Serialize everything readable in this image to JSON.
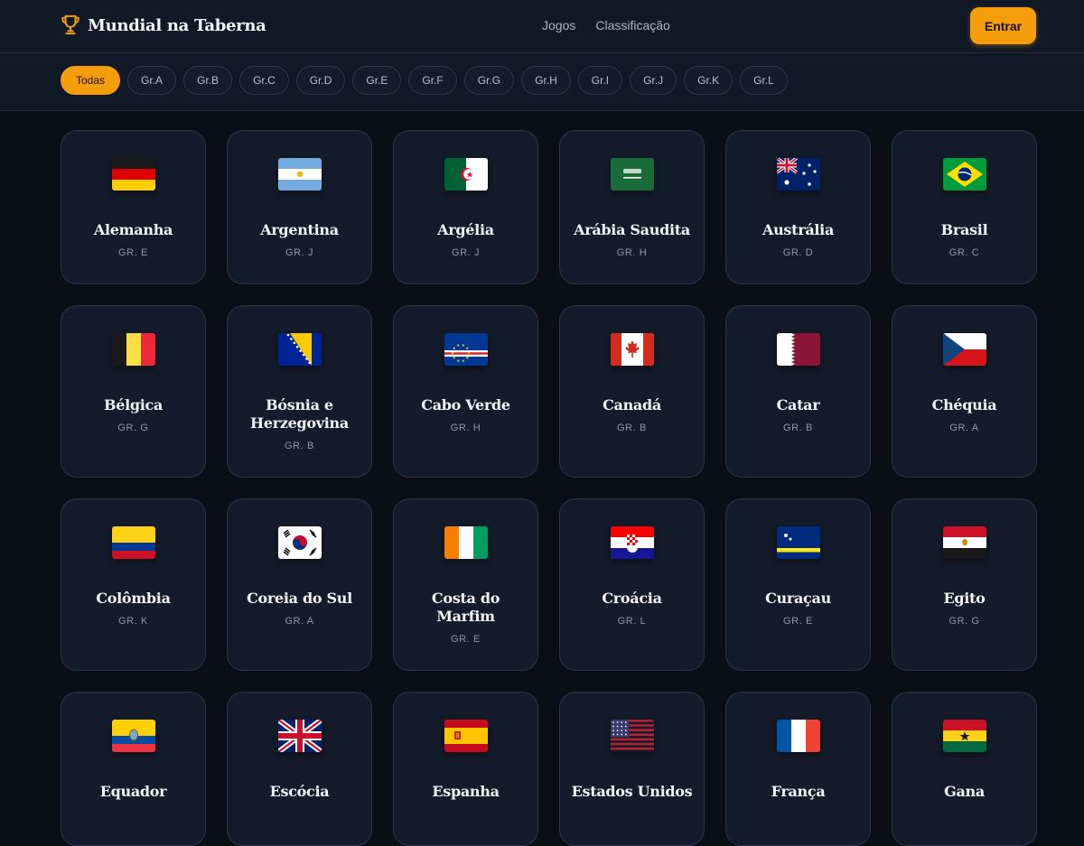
{
  "header": {
    "brand": "Mundial na Taberna",
    "nav": [
      "Jogos",
      "Classificação"
    ],
    "login_label": "Entrar"
  },
  "filters": [
    "Todas",
    "Gr.A",
    "Gr.B",
    "Gr.C",
    "Gr.D",
    "Gr.E",
    "Gr.F",
    "Gr.G",
    "Gr.H",
    "Gr.I",
    "Gr.J",
    "Gr.K",
    "Gr.L"
  ],
  "colors": {
    "accent": "#f59e0b",
    "background": "#0a0e16",
    "card": "#141c2b"
  },
  "teams": [
    {
      "name": "Alemanha",
      "group": "GR. E",
      "flag": "de"
    },
    {
      "name": "Argentina",
      "group": "GR. J",
      "flag": "ar"
    },
    {
      "name": "Argélia",
      "group": "GR. J",
      "flag": "dz"
    },
    {
      "name": "Arábia Saudita",
      "group": "GR. H",
      "flag": "sa"
    },
    {
      "name": "Austrália",
      "group": "GR. D",
      "flag": "au"
    },
    {
      "name": "Brasil",
      "group": "GR. C",
      "flag": "br"
    },
    {
      "name": "Bélgica",
      "group": "GR. G",
      "flag": "be"
    },
    {
      "name": "Bósnia e Herzegovina",
      "group": "GR. B",
      "flag": "ba"
    },
    {
      "name": "Cabo Verde",
      "group": "GR. H",
      "flag": "cv"
    },
    {
      "name": "Canadá",
      "group": "GR. B",
      "flag": "ca"
    },
    {
      "name": "Catar",
      "group": "GR. B",
      "flag": "qa"
    },
    {
      "name": "Chéquia",
      "group": "GR. A",
      "flag": "cz"
    },
    {
      "name": "Colômbia",
      "group": "GR. K",
      "flag": "co"
    },
    {
      "name": "Coreia do Sul",
      "group": "GR. A",
      "flag": "kr"
    },
    {
      "name": "Costa do Marfim",
      "group": "GR. E",
      "flag": "ci"
    },
    {
      "name": "Croácia",
      "group": "GR. L",
      "flag": "hr"
    },
    {
      "name": "Curaçau",
      "group": "GR. E",
      "flag": "cw"
    },
    {
      "name": "Egito",
      "group": "GR. G",
      "flag": "eg"
    },
    {
      "name": "Equador",
      "group": "",
      "flag": "ec"
    },
    {
      "name": "Escócia",
      "group": "",
      "flag": "gb"
    },
    {
      "name": "Espanha",
      "group": "",
      "flag": "es"
    },
    {
      "name": "Estados Unidos",
      "group": "",
      "flag": "us"
    },
    {
      "name": "França",
      "group": "",
      "flag": "fr"
    },
    {
      "name": "Gana",
      "group": "",
      "flag": "gh"
    }
  ]
}
